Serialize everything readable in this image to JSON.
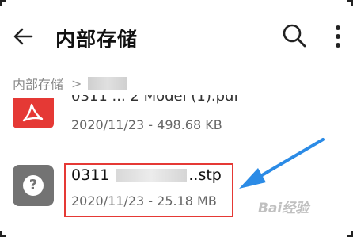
{
  "header": {
    "title": "内部存储"
  },
  "breadcrumb": {
    "root": "内部存储",
    "separator": ">"
  },
  "files": [
    {
      "name_fragment": "0311 ... 2 Model (1).pdf",
      "meta": "2020/11/23 - 498.68 KB",
      "icon": "pdf-icon"
    },
    {
      "name_prefix": "0311",
      "name_suffix": "..stp",
      "meta": "2020/11/23 - 25.18 MB",
      "icon": "unknown-file-icon",
      "highlighted": true
    }
  ],
  "colors": {
    "pdf_red": "#e53935",
    "unknown_gray": "#737373",
    "highlight_red": "#e53935",
    "arrow_blue": "#2b8be6"
  },
  "watermark": "Bai经验"
}
